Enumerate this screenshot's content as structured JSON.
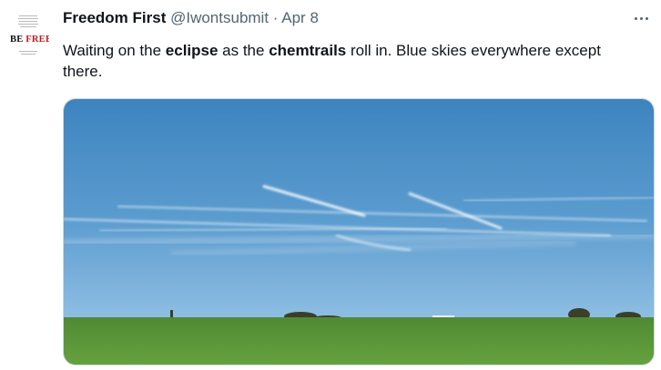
{
  "tweet": {
    "author_name": "Freedom First",
    "handle": "@Iwontsubmit",
    "separator": "·",
    "date": "Apr 8",
    "text_parts": [
      {
        "text": "Waiting on the ",
        "bold": false
      },
      {
        "text": "eclipse",
        "bold": true
      },
      {
        "text": " as the ",
        "bold": false
      },
      {
        "text": "chemtrails",
        "bold": true
      },
      {
        "text": " roll in. Blue skies everywhere except there.",
        "bold": false
      }
    ]
  },
  "avatar": {
    "brand_word1": "BE",
    "brand_word2": "FREE"
  },
  "icons": {
    "more": "more-horizontal-icon"
  },
  "colors": {
    "text": "#0f1419",
    "secondary": "#536471",
    "sky_top": "#3f86c0",
    "sky_bottom": "#a9d0ec",
    "grass": "#5a9338"
  }
}
